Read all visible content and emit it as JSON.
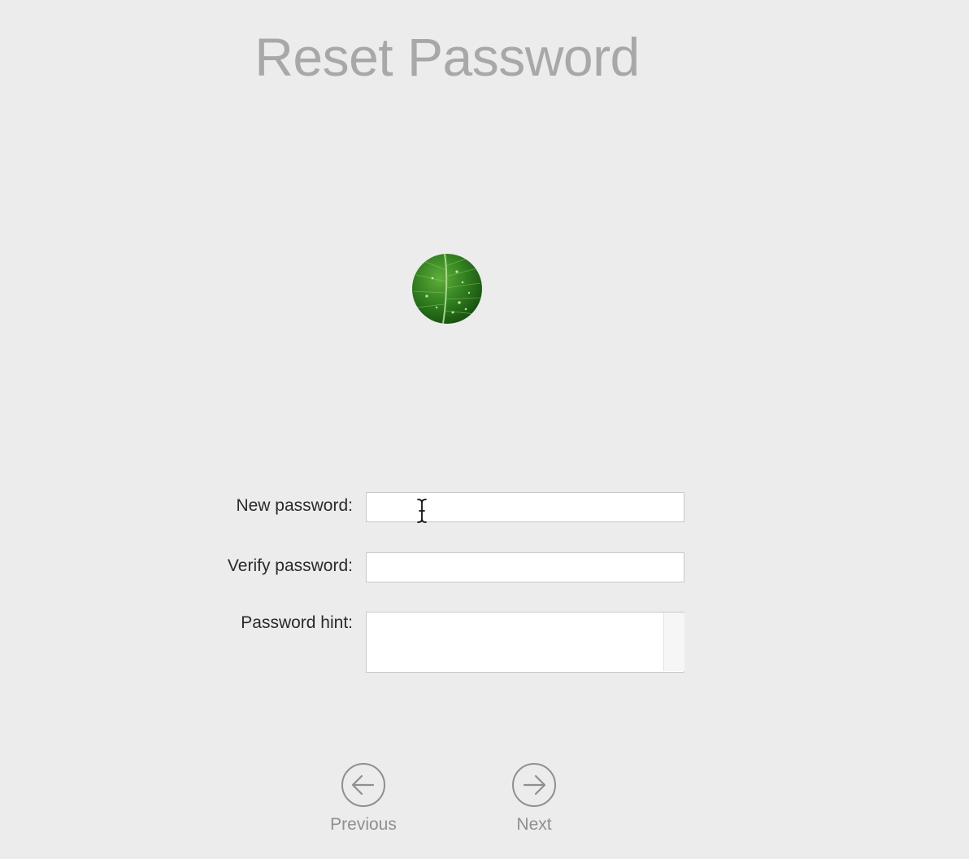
{
  "header": {
    "title": "Reset Password"
  },
  "avatar": {
    "icon": "green-leaf-avatar"
  },
  "form": {
    "new_password": {
      "label": "New password:",
      "value": "",
      "placeholder": ""
    },
    "verify_password": {
      "label": "Verify password:",
      "value": "",
      "placeholder": ""
    },
    "password_hint": {
      "label": "Password hint:",
      "value": "",
      "placeholder": ""
    }
  },
  "navigation": {
    "previous": {
      "label": "Previous",
      "icon": "arrow-left-circle-icon"
    },
    "next": {
      "label": "Next",
      "icon": "arrow-right-circle-icon"
    }
  },
  "colors": {
    "background": "#ececec",
    "title": "#a8a8a8",
    "nav_label": "#8f8f8f"
  }
}
